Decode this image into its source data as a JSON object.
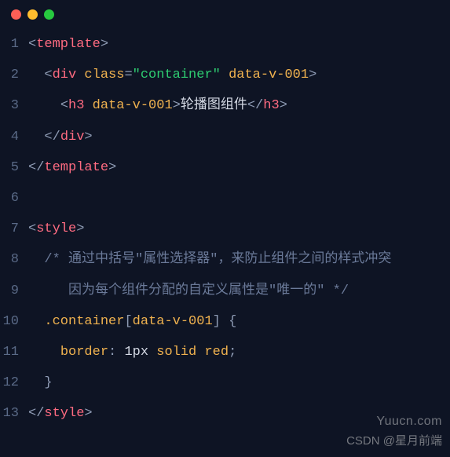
{
  "window": {
    "traffic_lights": [
      "close",
      "minimize",
      "zoom"
    ]
  },
  "code": {
    "lines": [
      {
        "n": 1,
        "tokens": [
          {
            "t": "<",
            "c": "punct"
          },
          {
            "t": "template",
            "c": "tag"
          },
          {
            "t": ">",
            "c": "punct"
          }
        ]
      },
      {
        "n": 2,
        "indent": "  ",
        "tokens": [
          {
            "t": "<",
            "c": "punct"
          },
          {
            "t": "div",
            "c": "tag"
          },
          {
            "t": " "
          },
          {
            "t": "class",
            "c": "attr"
          },
          {
            "t": "=",
            "c": "punct"
          },
          {
            "t": "\"container\"",
            "c": "str"
          },
          {
            "t": " "
          },
          {
            "t": "data-v-001",
            "c": "attr"
          },
          {
            "t": ">",
            "c": "punct"
          }
        ]
      },
      {
        "n": 3,
        "indent": "    ",
        "tokens": [
          {
            "t": "<",
            "c": "punct"
          },
          {
            "t": "h3",
            "c": "tag"
          },
          {
            "t": " "
          },
          {
            "t": "data-v-001",
            "c": "attr"
          },
          {
            "t": ">",
            "c": "punct"
          },
          {
            "t": "轮播图组件"
          },
          {
            "t": "</",
            "c": "punct"
          },
          {
            "t": "h3",
            "c": "tag"
          },
          {
            "t": ">",
            "c": "punct"
          }
        ]
      },
      {
        "n": 4,
        "indent": "  ",
        "tokens": [
          {
            "t": "</",
            "c": "punct"
          },
          {
            "t": "div",
            "c": "tag"
          },
          {
            "t": ">",
            "c": "punct"
          }
        ]
      },
      {
        "n": 5,
        "tokens": [
          {
            "t": "</",
            "c": "punct"
          },
          {
            "t": "template",
            "c": "tag"
          },
          {
            "t": ">",
            "c": "punct"
          }
        ]
      },
      {
        "n": 6,
        "tokens": []
      },
      {
        "n": 7,
        "tokens": [
          {
            "t": "<",
            "c": "punct"
          },
          {
            "t": "style",
            "c": "tag"
          },
          {
            "t": ">",
            "c": "punct"
          }
        ]
      },
      {
        "n": 8,
        "indent": "  ",
        "tokens": [
          {
            "t": "/* 通过中括号\"属性选择器\"，来防止组件之间的样式冲突",
            "c": "cmt"
          }
        ]
      },
      {
        "n": 9,
        "indent": "     ",
        "tokens": [
          {
            "t": "因为每个组件分配的自定义属性是\"唯一的\" */",
            "c": "cmt"
          }
        ]
      },
      {
        "n": 10,
        "indent": "  ",
        "tokens": [
          {
            "t": ".container",
            "c": "sel"
          },
          {
            "t": "[",
            "c": "selb"
          },
          {
            "t": "data-v-001",
            "c": "attr"
          },
          {
            "t": "]",
            "c": "selb"
          },
          {
            "t": " {",
            "c": "punct"
          }
        ]
      },
      {
        "n": 11,
        "indent": "    ",
        "tokens": [
          {
            "t": "border",
            "c": "attr"
          },
          {
            "t": ": ",
            "c": "punct"
          },
          {
            "t": "1px"
          },
          {
            "t": " "
          },
          {
            "t": "solid",
            "c": "sel"
          },
          {
            "t": " "
          },
          {
            "t": "red",
            "c": "sel"
          },
          {
            "t": ";",
            "c": "punct"
          }
        ]
      },
      {
        "n": 12,
        "indent": "  ",
        "tokens": [
          {
            "t": "}",
            "c": "punct"
          }
        ]
      },
      {
        "n": 13,
        "tokens": [
          {
            "t": "</",
            "c": "punct"
          },
          {
            "t": "style",
            "c": "tag"
          },
          {
            "t": ">",
            "c": "punct"
          }
        ]
      }
    ]
  },
  "watermarks": {
    "site": "Yuucn.com",
    "credit": "CSDN @星月前端"
  }
}
